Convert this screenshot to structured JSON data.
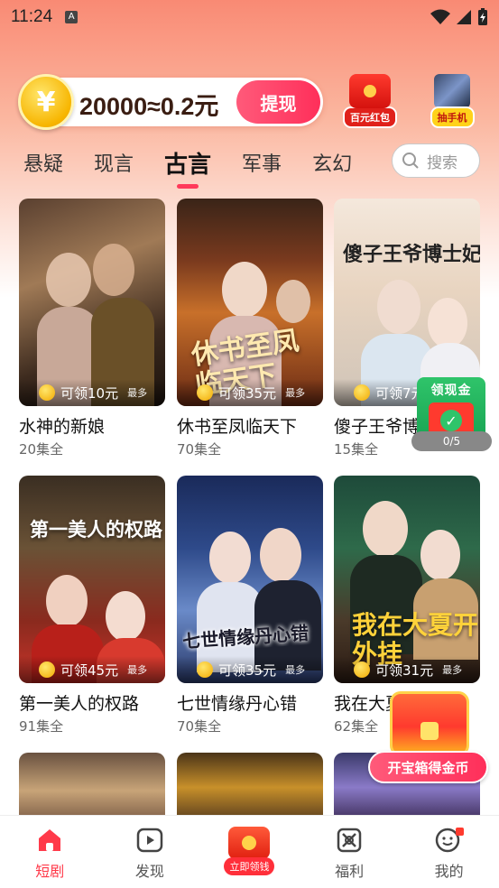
{
  "status": {
    "time": "11:24",
    "a_badge": "A"
  },
  "coins": {
    "amount_text": "20000≈0.2元",
    "withdraw_label": "提现",
    "coin_symbol": "¥"
  },
  "promos": [
    {
      "label": "百元红包",
      "icon": "red-envelope-icon"
    },
    {
      "label": "抽手机",
      "icon": "phone-icon"
    }
  ],
  "tabs": [
    {
      "label": "悬疑",
      "active": false
    },
    {
      "label": "现言",
      "active": false
    },
    {
      "label": "古言",
      "active": true
    },
    {
      "label": "军事",
      "active": false
    },
    {
      "label": "玄幻",
      "active": false
    }
  ],
  "search": {
    "placeholder": "搜索"
  },
  "cards": [
    {
      "title": "水神的新娘",
      "episodes": "20集全",
      "reward": "可领10元",
      "most": "最多"
    },
    {
      "title": "休书至凤临天下",
      "episodes": "70集全",
      "reward": "可领35元",
      "most": "最多",
      "poster_text": "休书至凤临天下"
    },
    {
      "title": "傻子王爷博士妃",
      "episodes": "15集全",
      "reward": "可领7元",
      "most": "最多",
      "poster_text": "傻子王爷博士妃"
    },
    {
      "title": "第一美人的权路",
      "episodes": "91集全",
      "reward": "可领45元",
      "most": "最多",
      "poster_text": "第一美人的权路"
    },
    {
      "title": "七世情缘丹心错",
      "episodes": "70集全",
      "reward": "可领35元",
      "most": "最多",
      "poster_text": "七世情缘丹心错"
    },
    {
      "title": "我在大夏开外挂",
      "episodes": "62集全",
      "reward": "可领31元",
      "most": "最多",
      "poster_text": "我在大夏开外挂"
    }
  ],
  "cash_widget": {
    "title": "领现金",
    "progress": "0/5"
  },
  "treasure": {
    "button_label": "开宝箱得金币"
  },
  "bottom_nav": [
    {
      "label": "短剧",
      "icon": "home-icon",
      "active": true
    },
    {
      "label": "发现",
      "icon": "play-icon",
      "active": false
    },
    {
      "label": "立即领钱",
      "icon": "red-envelope-icon",
      "active": false
    },
    {
      "label": "福利",
      "icon": "gift-grid-icon",
      "active": false
    },
    {
      "label": "我的",
      "icon": "smiley-icon",
      "active": false
    }
  ],
  "colors": {
    "accent": "#ff3a5a",
    "header_gradient_top": "#f98a74",
    "coin_gold": "#f7b500"
  }
}
